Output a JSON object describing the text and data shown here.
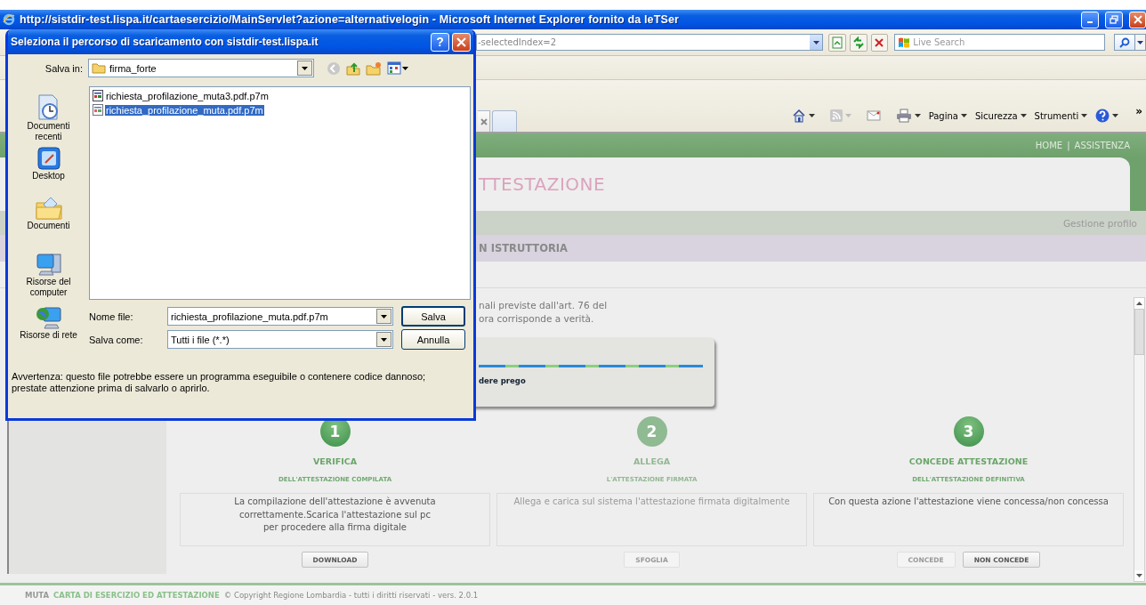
{
  "window": {
    "title": "http://sistdir-test.lispa.it/cartaesercizio/MainServlet?azione=alternativelogin - Microsoft Internet Explorer fornito da leTSer"
  },
  "address_bar": {
    "value": "-selectedIndex=2"
  },
  "search": {
    "placeholder": "Live Search"
  },
  "command_bar": {
    "menus": [
      "Pagina",
      "Sicurezza",
      "Strumenti"
    ],
    "overflow": "»"
  },
  "page": {
    "top_links": [
      "HOME",
      "ASSISTENZA"
    ],
    "link_separator": "|",
    "heading": "TTESTAZIONE",
    "nav_link": "Gestione profilo",
    "status_band": "N ISTRUTTORIA",
    "declaration_lines": [
      "nali previste dall'art. 76 del",
      "ora corrisponde a verità."
    ],
    "loading": {
      "message": "dere prego"
    },
    "steps": [
      {
        "number": "1",
        "title": "VERIFICA",
        "subtitle": "DELL'ATTESTAZIONE COMPILATA",
        "enabled": true,
        "description_lines": [
          "La compilazione dell'attestazione è avvenuta",
          "correttamente.Scarica l'attestazione sul pc",
          "per procedere alla firma digitale"
        ],
        "buttons": [
          {
            "label": "DOWNLOAD",
            "enabled": true
          }
        ]
      },
      {
        "number": "2",
        "title": "ALLEGA",
        "subtitle": "L'ATTESTAZIONE FIRMATA",
        "enabled": false,
        "description_lines": [
          "Allega e carica sul sistema l'attestazione firmata digitalmente"
        ],
        "buttons": [
          {
            "label": "SFOGLIA",
            "enabled": false
          }
        ]
      },
      {
        "number": "3",
        "title": "CONCEDE ATTESTAZIONE",
        "subtitle": "DELL'ATTESTAZIONE DEFINITIVA",
        "enabled": true,
        "description_lines": [
          "Con questa azione l'attestazione viene concessa/non concessa"
        ],
        "buttons": [
          {
            "label": "CONCEDE",
            "enabled": false
          },
          {
            "label": "NON CONCEDE",
            "enabled": true
          }
        ]
      }
    ]
  },
  "footer": {
    "brand": "MUTA",
    "title": "CARTA DI ESERCIZIO ED ATTESTAZIONE",
    "copyright": "© Copyright Regione Lombardia - tutti i diritti riservati - vers. 2.0.1"
  },
  "dialog": {
    "title": "Seleziona il percorso di scaricamento con sistdir-test.lispa.it",
    "help": "?",
    "save_in_label": "Salva in:",
    "save_in_value": "firma_forte",
    "places": [
      {
        "kind": "recent",
        "label": "Documenti recenti"
      },
      {
        "kind": "desktop",
        "label": "Desktop"
      },
      {
        "kind": "documents",
        "label": "Documenti"
      },
      {
        "kind": "computer",
        "label": "Risorse del computer"
      },
      {
        "kind": "network",
        "label": "Risorse di rete"
      }
    ],
    "files": [
      {
        "name": "richiesta_profilazione_muta3.pdf.p7m",
        "selected": false
      },
      {
        "name": "richiesta_profilazione_muta.pdf.p7m",
        "selected": true
      }
    ],
    "file_name_label": "Nome file:",
    "file_name": "richiesta_profilazione_muta.pdf.p7m",
    "file_type_label": "Salva come:",
    "file_type": "Tutti i file (*.*)",
    "buttons": [
      "Salva",
      "Annulla"
    ],
    "warning": "Avvertenza: questo file potrebbe essere un programma eseguibile o contenere codice dannoso; prestate attenzione prima di salvarlo o aprirlo."
  }
}
